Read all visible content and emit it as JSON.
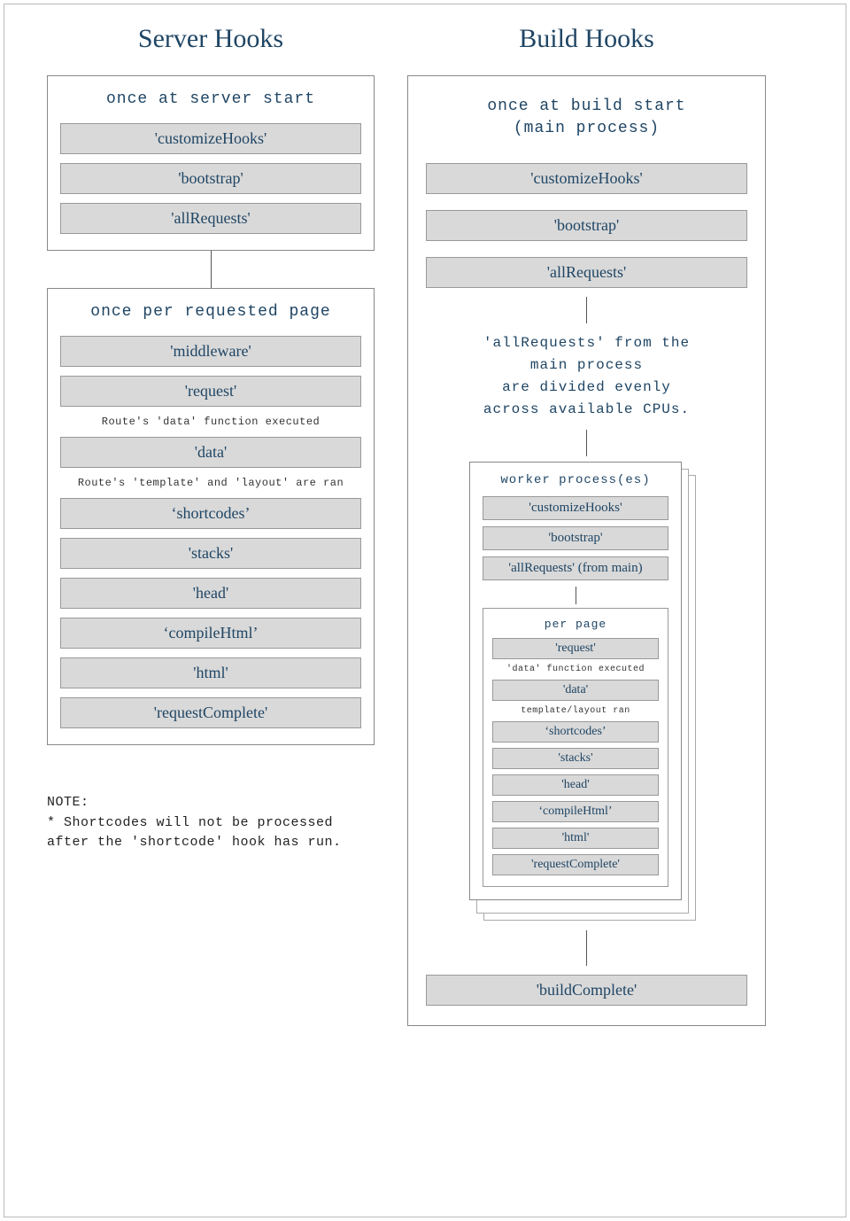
{
  "left": {
    "title": "Server Hooks",
    "panel1": {
      "title": "once at server start",
      "hooks": [
        "'customizeHooks'",
        "'bootstrap'",
        "'allRequests'"
      ]
    },
    "panel2": {
      "title": "once per requested page",
      "h_middleware": "'middleware'",
      "h_request": "'request'",
      "note_data_fn": "Route's 'data' function executed",
      "h_data": "'data'",
      "note_tpl": "Route's 'template' and 'layout' are ran",
      "h_shortcodes": "‘shortcodes’",
      "h_stacks": "'stacks'",
      "h_head": "'head'",
      "h_compile": "‘compileHtml’",
      "h_html": "'html'",
      "h_reqComplete": "'requestComplete'"
    },
    "note_line1": "NOTE:",
    "note_line2": "* Shortcodes will not be processed",
    "note_line3": "after the 'shortcode' hook has run."
  },
  "right": {
    "title": "Build Hooks",
    "main_panel": {
      "title_l1": "once at build start",
      "title_l2": "(main process)",
      "hooks": [
        "'customizeHooks'",
        "'bootstrap'",
        "'allRequests'"
      ],
      "divider_l1": "'allRequests' from the",
      "divider_l2": "main process",
      "divider_l3": "are divided evenly",
      "divider_l4": "across available CPUs.",
      "worker": {
        "title": "worker process(es)",
        "h_custom": "'customizeHooks'",
        "h_boot": "'bootstrap'",
        "h_allReq": "'allRequests' (from main)",
        "inner": {
          "title": "per page",
          "h_request": "'request'",
          "note_data_fn": "'data' function executed",
          "h_data": "'data'",
          "note_tpl": "template/layout ran",
          "h_shortcodes": "‘shortcodes’",
          "h_stacks": "'stacks'",
          "h_head": "'head'",
          "h_compile": "‘compileHtml’",
          "h_html": "'html'",
          "h_reqComplete": "'requestComplete'"
        }
      },
      "h_buildComplete": "'buildComplete'"
    }
  }
}
